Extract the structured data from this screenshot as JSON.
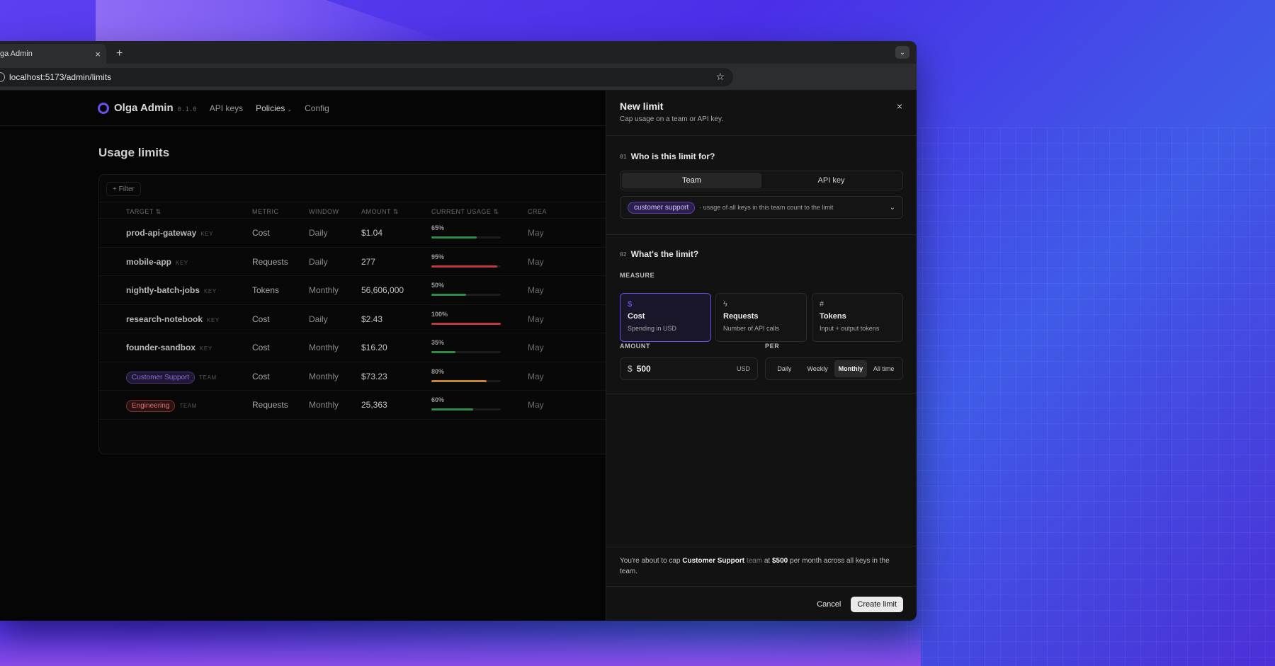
{
  "browser": {
    "tab_title": "ga Admin",
    "tab_close": "×",
    "new_tab": "+",
    "url": "localhost:5173/admin/limits"
  },
  "app": {
    "logo": "Olga Admin",
    "version": "0.1.0",
    "nav": [
      {
        "label": "API keys"
      },
      {
        "label": "Policies"
      },
      {
        "label": "Config"
      }
    ],
    "page_title": "Usage limits",
    "filter_label": "+ Filter",
    "columns": [
      "TARGET",
      "METRIC",
      "WINDOW",
      "AMOUNT",
      "CURRENT USAGE",
      "CREA"
    ],
    "rows": [
      {
        "target": "prod-api-gateway",
        "kind": "KEY",
        "metric": "Cost",
        "window": "Daily",
        "amount": "$1.04",
        "usage": "65%",
        "usage_value": 0.65,
        "bar_color": "#2e8b4a",
        "created": "May"
      },
      {
        "target": "mobile-app",
        "kind": "KEY",
        "metric": "Requests",
        "window": "Daily",
        "amount": "277",
        "usage": "95%",
        "usage_value": 0.95,
        "bar_color": "#c0393b",
        "created": "May"
      },
      {
        "target": "nightly-batch-jobs",
        "kind": "KEY",
        "metric": "Tokens",
        "window": "Monthly",
        "amount": "56,606,000",
        "usage": "50%",
        "usage_value": 0.5,
        "bar_color": "#2e8b4a",
        "created": "May"
      },
      {
        "target": "research-notebook",
        "kind": "KEY",
        "metric": "Cost",
        "window": "Daily",
        "amount": "$2.43",
        "usage": "100%",
        "usage_value": 1.0,
        "bar_color": "#c0393b",
        "created": "May"
      },
      {
        "target": "founder-sandbox",
        "kind": "KEY",
        "metric": "Cost",
        "window": "Monthly",
        "amount": "$16.20",
        "usage": "35%",
        "usage_value": 0.35,
        "bar_color": "#2e8b4a",
        "created": "May"
      },
      {
        "target": "Customer Support",
        "kind": "TEAM",
        "pill": true,
        "pill_color": "#8f6fd8",
        "pill_bg": "#1f1733",
        "pill_border": "#4a3580",
        "metric": "Cost",
        "window": "Monthly",
        "amount": "$73.23",
        "usage": "80%",
        "usage_value": 0.8,
        "bar_color": "#c7862a",
        "created": "May"
      },
      {
        "target": "Engineering",
        "kind": "TEAM",
        "pill": true,
        "pill_color": "#e07070",
        "pill_bg": "#2a1212",
        "pill_border": "#7a2e2e",
        "metric": "Requests",
        "window": "Monthly",
        "amount": "25,363",
        "usage": "60%",
        "usage_value": 0.6,
        "bar_color": "#2e8b4a",
        "created": "May"
      }
    ]
  },
  "drawer": {
    "title": "New limit",
    "subtitle": "Cap usage on a team or API key.",
    "close": "×",
    "step1": {
      "num": "01",
      "title": "Who is this limit for?"
    },
    "target_tabs": [
      {
        "label": "Team",
        "active": true
      },
      {
        "label": "API key",
        "active": false
      }
    ],
    "team_pill": "customer support",
    "team_note": "· usage of all keys in this team count to the limit",
    "step2": {
      "num": "02",
      "title": "What's the limit?"
    },
    "measure_label": "MEASURE",
    "measures": [
      {
        "icon": "$",
        "name": "Cost",
        "desc": "Spending in USD",
        "active": true
      },
      {
        "icon": "ϟ",
        "name": "Requests",
        "desc": "Number of API calls",
        "active": false
      },
      {
        "icon": "#",
        "name": "Tokens",
        "desc": "Input + output tokens",
        "active": false
      }
    ],
    "amount_label": "AMOUNT",
    "amount_currency": "$",
    "amount_value": "500",
    "amount_unit": "USD",
    "per_label": "PER",
    "per_options": [
      {
        "label": "Daily",
        "active": false
      },
      {
        "label": "Weekly",
        "active": false
      },
      {
        "label": "Monthly",
        "active": true
      },
      {
        "label": "All time",
        "active": false
      }
    ],
    "summary": {
      "pre": "You're about to cap ",
      "team": "Customer Support",
      "team_word": " team",
      "at": " at ",
      "amount": "$500",
      "post": " per month across all keys in the team."
    },
    "cancel": "Cancel",
    "create": "Create limit"
  },
  "colors": {
    "accent": "#6a4ff0"
  }
}
